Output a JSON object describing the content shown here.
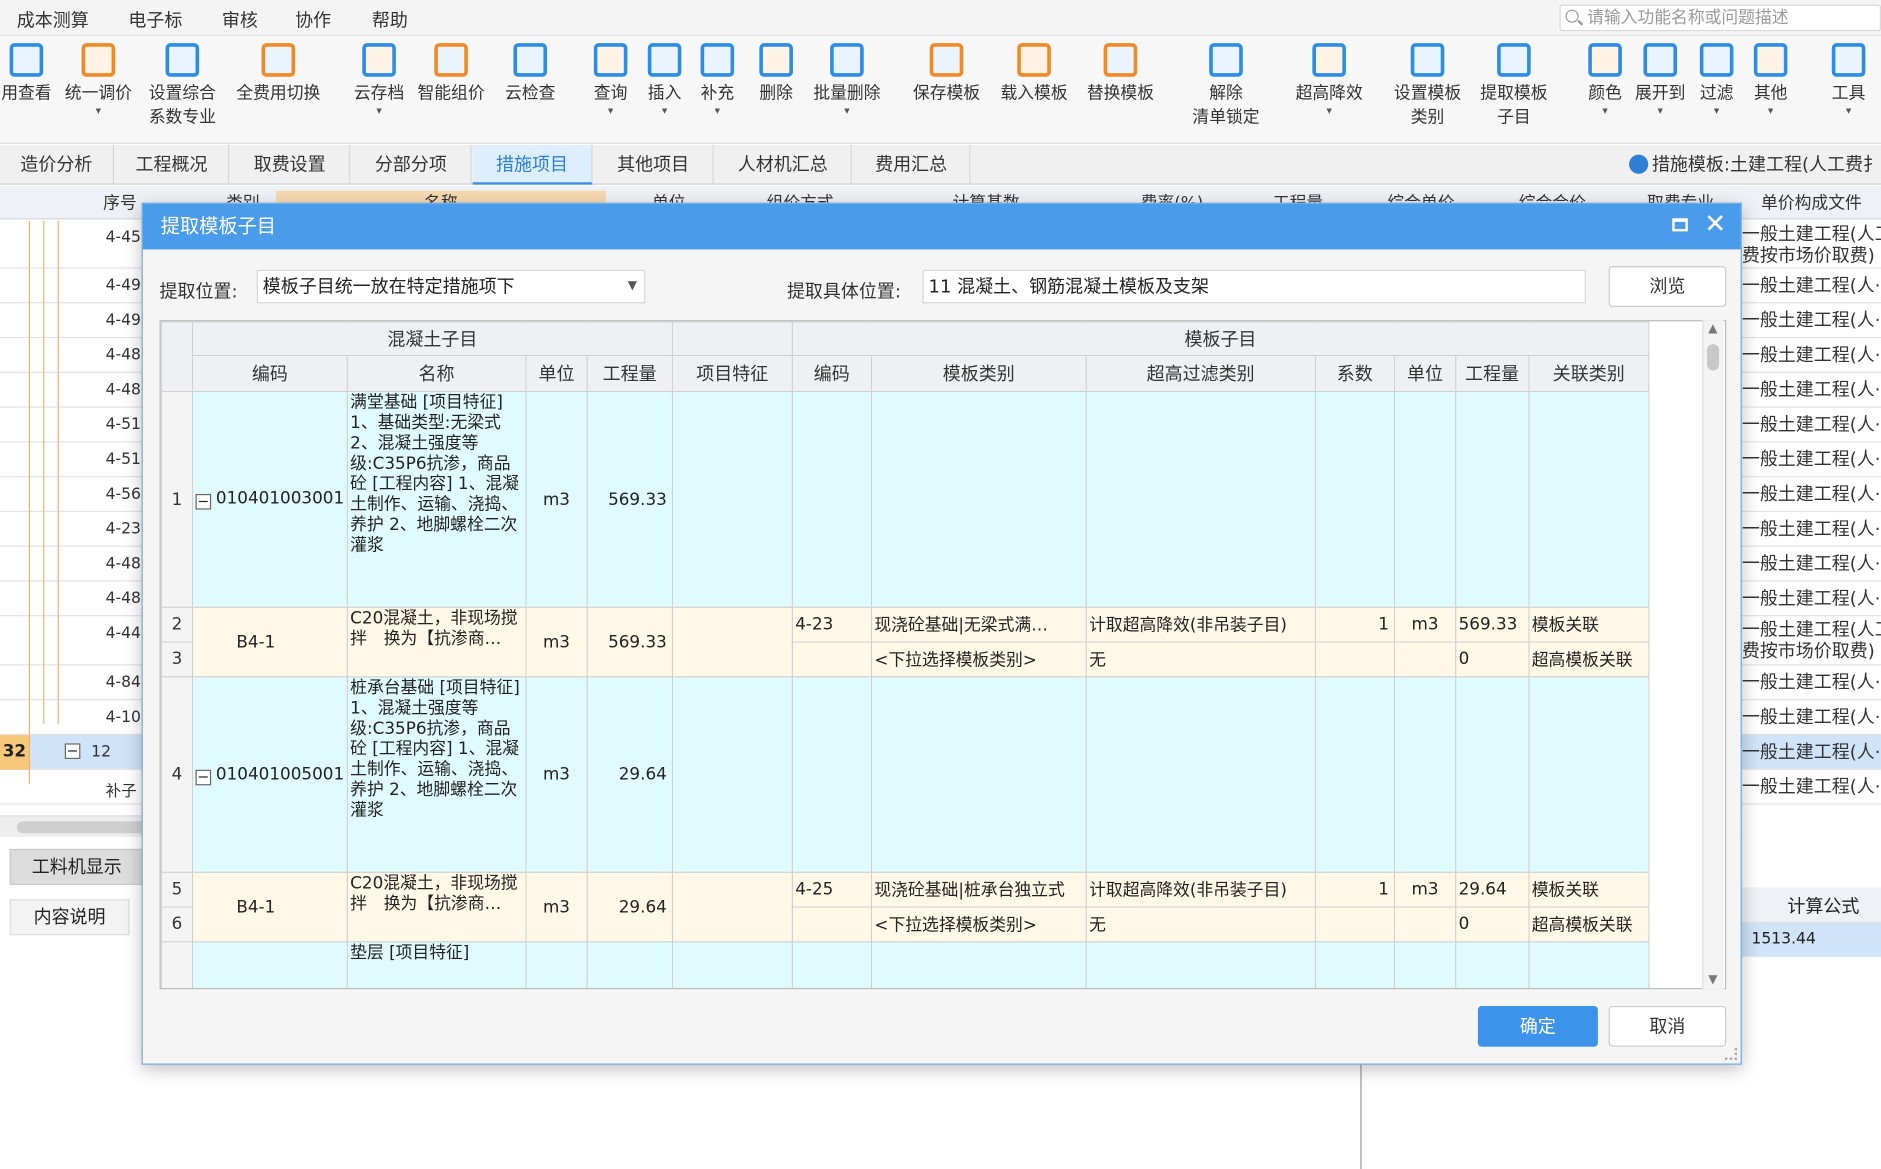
{
  "menu": [
    "成本测算",
    "电子标",
    "审核",
    "协作",
    "帮助"
  ],
  "search": {
    "placeholder": "请输入功能名称或问题描述"
  },
  "toolbar": [
    {
      "label": "用查看",
      "color": "#2b8de6"
    },
    {
      "label": "统一调价",
      "color": "#f08a24"
    },
    {
      "label": "设置综合\n系数专业",
      "color": "#2b8de6"
    },
    {
      "label": "全费用切换",
      "color": "#f08a24"
    },
    {
      "label": "云存档",
      "color": "#2b8de6"
    },
    {
      "label": "智能组价",
      "color": "#f08a24"
    },
    {
      "label": "云检查",
      "color": "#2b8de6"
    },
    {
      "label": "查询",
      "color": "#2b8de6"
    },
    {
      "label": "插入",
      "color": "#2b8de6"
    },
    {
      "label": "补充",
      "color": "#2b8de6"
    },
    {
      "label": "删除",
      "color": "#2b8de6"
    },
    {
      "label": "批量删除",
      "color": "#2b8de6"
    },
    {
      "label": "保存模板",
      "color": "#f08a24"
    },
    {
      "label": "载入模板",
      "color": "#f08a24"
    },
    {
      "label": "替换模板",
      "color": "#f08a24"
    },
    {
      "label": "解除\n清单锁定",
      "color": "#2b8de6"
    },
    {
      "label": "超高降效",
      "color": "#2b8de6"
    },
    {
      "label": "设置模板\n类别",
      "color": "#2b8de6"
    },
    {
      "label": "提取模板\n子目",
      "color": "#2b8de6"
    },
    {
      "label": "颜色",
      "color": "#2b8de6"
    },
    {
      "label": "展开到",
      "color": "#2b8de6"
    },
    {
      "label": "过滤",
      "color": "#2b8de6"
    },
    {
      "label": "其他",
      "color": "#2b8de6"
    },
    {
      "label": "工具",
      "color": "#2b8de6"
    }
  ],
  "tabs": [
    "造价分析",
    "工程概况",
    "取费设置",
    "分部分项",
    "措施项目",
    "其他项目",
    "人材机汇总",
    "费用汇总"
  ],
  "active_tab": "措施项目",
  "tab_info": "措施模板:土建工程(人工费扌",
  "bg_headers": [
    "序号",
    "类别",
    "名称",
    "单位",
    "组价方式",
    "计算基数",
    "费率(%)",
    "工程量",
    "综合单价",
    "综合合价",
    "取费专业",
    "单价构成文件"
  ],
  "bg_rows": [
    {
      "code": "4-45",
      "right": "一般土建工程(人工",
      "right2": "费按市场价取费)"
    },
    {
      "code": "4-49",
      "right": "一般土建工程(人·"
    },
    {
      "code": "4-49",
      "right": "一般土建工程(人·"
    },
    {
      "code": "4-48",
      "right": "一般土建工程(人·"
    },
    {
      "code": "4-48",
      "right": "一般土建工程(人·"
    },
    {
      "code": "4-51",
      "right": "一般土建工程(人·"
    },
    {
      "code": "4-51",
      "right": "一般土建工程(人·"
    },
    {
      "code": "4-56",
      "right": "一般土建工程(人·"
    },
    {
      "code": "4-23",
      "right": "一般土建工程(人·"
    },
    {
      "code": "4-48",
      "right": "一般土建工程(人·"
    },
    {
      "code": "4-48",
      "right": "一般土建工程(人·"
    },
    {
      "code": "4-44",
      "right": "一般土建工程(人工",
      "right2": "费按市场价取费)"
    },
    {
      "code": "4-84",
      "right": "一般土建工程(人·"
    },
    {
      "code": "4-10",
      "right": "一般土建工程(人·"
    },
    {
      "code": "12",
      "num": "32",
      "right": "一般土建工程(人·"
    },
    {
      "code": "补子",
      "right": "一般土建工程(人·"
    }
  ],
  "bottom": {
    "tab1": "工料机显示",
    "tab2": "内容说明",
    "formula_header": "计算公式",
    "formula_value": "1513.44"
  },
  "dialog": {
    "title": "提取模板子目",
    "pos_label": "提取位置:",
    "pos_value": "模板子目统一放在特定措施项下",
    "detail_label": "提取具体位置:",
    "detail_value": "11 混凝土、钢筋混凝土模板及支架",
    "browse": "浏览",
    "ok": "确定",
    "cancel": "取消",
    "group_left": "混凝土子目",
    "group_right": "模板子目",
    "cols": [
      "编码",
      "名称",
      "单位",
      "工程量",
      "项目特征",
      "编码",
      "模板类别",
      "超高过滤类别",
      "系数",
      "单位",
      "工程量",
      "关联类别"
    ],
    "rows": [
      {
        "no": "1",
        "code": "010401003001",
        "name": "满堂基础\n[项目特征]\n1、基础类型:无梁式\n2、混凝土强度等级:C35P6抗渗，商品砼\n[工程内容]\n1、混凝土制作、运输、浇捣、养护\n2、地脚螺栓二次灌浆",
        "unit": "m3",
        "qty": "569.33"
      },
      {
        "no": "2",
        "code": "B4-1",
        "name": "C20混凝土，非现场搅拌　换为【抗渗商…",
        "unit": "m3",
        "qty": "569.33",
        "m_code": "4-23",
        "m_type": "现浇砼基础|无梁式满…",
        "m_filter": "计取超高降效(非吊装子目)",
        "m_coef": "1",
        "m_unit": "m3",
        "m_qty": "569.33",
        "m_rel": "模板关联"
      },
      {
        "no": "3",
        "m_type": "<下拉选择模板类别>",
        "m_filter": "无",
        "m_qty": "0",
        "m_rel": "超高模板关联"
      },
      {
        "no": "4",
        "code": "010401005001",
        "name": "桩承台基础\n[项目特征]\n1、混凝土强度等级:C35P6抗渗，商品砼\n[工程内容]\n1、混凝土制作、运输、浇捣、养护\n2、地脚螺栓二次灌浆",
        "unit": "m3",
        "qty": "29.64"
      },
      {
        "no": "5",
        "code": "B4-1",
        "name": "C20混凝土，非现场搅拌　换为【抗渗商…",
        "unit": "m3",
        "qty": "29.64",
        "m_code": "4-25",
        "m_type": "现浇砼基础|桩承台独立式",
        "m_filter": "计取超高降效(非吊装子目)",
        "m_coef": "1",
        "m_unit": "m3",
        "m_qty": "29.64",
        "m_rel": "模板关联"
      },
      {
        "no": "6",
        "m_type": "<下拉选择模板类别>",
        "m_filter": "无",
        "m_qty": "0",
        "m_rel": "超高模板关联"
      },
      {
        "no": "",
        "name": "垫层\n[项目特征]"
      }
    ]
  }
}
